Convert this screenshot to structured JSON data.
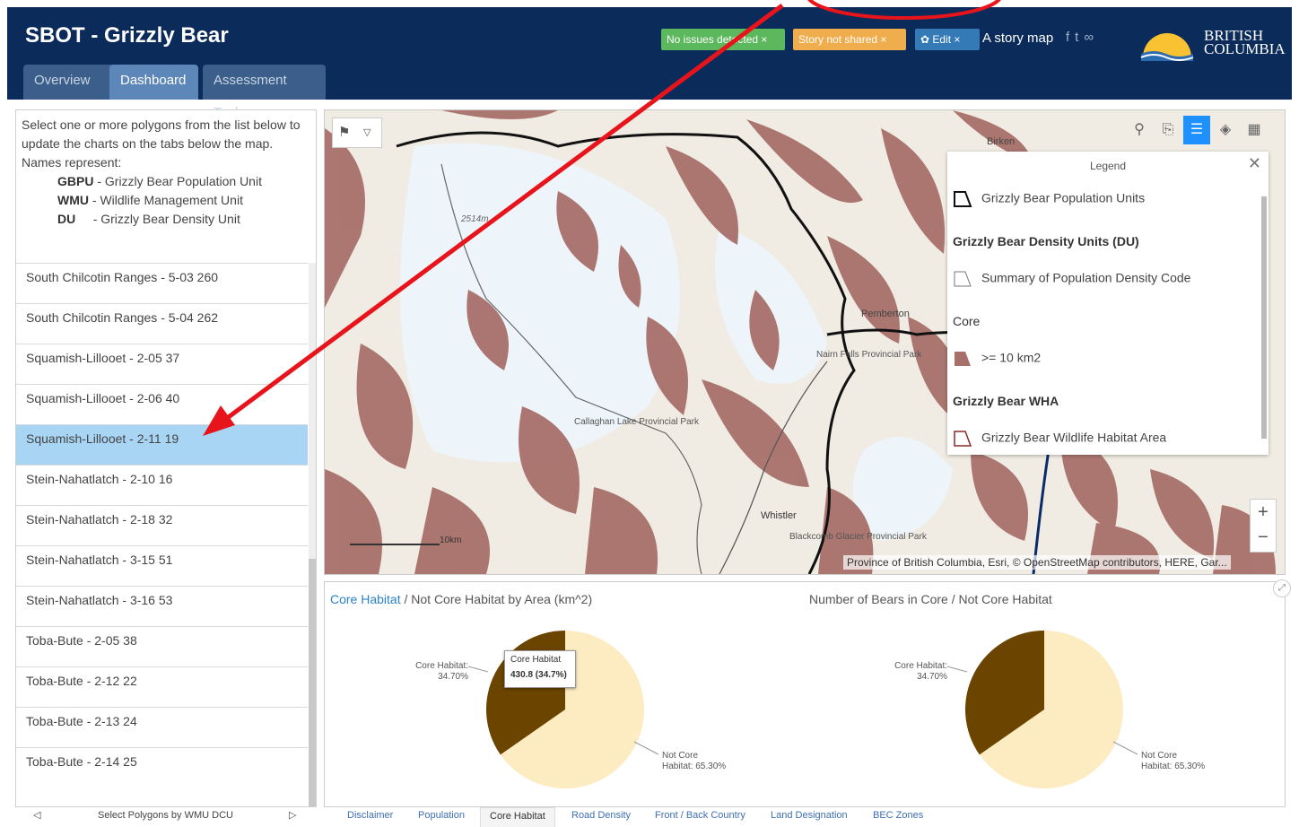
{
  "header": {
    "title": "SBOT - Grizzly Bear",
    "tabs": [
      {
        "label": "Overview"
      },
      {
        "label": "Dashboard"
      },
      {
        "label": "Assessment Tool"
      }
    ],
    "badges": {
      "issues": "No issues detected ×",
      "story": "Story not shared ×",
      "edit": "Edit ×"
    },
    "story_map": "A story map",
    "logo_line1": "BRITISH",
    "logo_line2": "COLUMBIA",
    "colors": {
      "header_bg": "#0b2b5a",
      "badge_green": "#5cb85c",
      "badge_orange": "#f0ad4e",
      "badge_blue": "#337ab7"
    }
  },
  "left_panel": {
    "intro": "Select one or more polygons from the list below to update the charts on the tabs below the map. Names represent:",
    "legend": [
      {
        "code": "GBPU",
        "desc": "- Grizzly Bear Population Unit"
      },
      {
        "code": "WMU",
        "desc": "- Wildlife Management Unit"
      },
      {
        "code": "DU",
        "desc": "- Grizzly Bear Density Unit"
      }
    ],
    "items": [
      "South Chilcotin Ranges - 5-03  260",
      "South Chilcotin Ranges - 5-04  262",
      "Squamish-Lillooet - 2-05  37",
      "Squamish-Lillooet - 2-06  40",
      "Squamish-Lillooet - 2-11  19",
      "Stein-Nahatlatch - 2-10  16",
      "Stein-Nahatlatch - 2-18  32",
      "Stein-Nahatlatch - 3-15  51",
      "Stein-Nahatlatch - 3-16  53",
      "Toba-Bute - 2-05  38",
      "Toba-Bute - 2-12  22",
      "Toba-Bute - 2-13  24",
      "Toba-Bute - 2-14  25"
    ],
    "selected_index": 4,
    "pager_label": "Select Polygons by WMU DCU",
    "pager_prev": "◁",
    "pager_next": "▷"
  },
  "map": {
    "place_labels": [
      "Birken",
      "Pemberton",
      "Nairn Falls Provincial Park",
      "Callaghan Lake Provincial Park",
      "Whistler",
      "Blackcomb Glacier Provincial Park",
      "2514m",
      "10km"
    ],
    "attribution": "Province of British Columbia, Esri, © OpenStreetMap contributors, HERE, Gar...",
    "legend": {
      "title": "Legend",
      "entries": [
        {
          "type": "item",
          "label": "Grizzly Bear Population Units"
        },
        {
          "type": "head",
          "label": "Grizzly Bear Density Units (DU)"
        },
        {
          "type": "item",
          "label": "Summary of Population Density Code"
        },
        {
          "type": "head",
          "label": "Core"
        },
        {
          "type": "item",
          "label": ">= 10 km2"
        },
        {
          "type": "head",
          "label": "Grizzly Bear WHA"
        },
        {
          "type": "item",
          "label": "Grizzly Bear Wildlife Habitat Area"
        }
      ]
    },
    "colors": {
      "core": "#a8706a",
      "snow": "#eef5fa",
      "terrain": "#f0ece3"
    }
  },
  "charts": {
    "chart1_title_hl": "Core Habitat",
    "chart1_title_rest": " / Not Core Habitat by Area (km^2)",
    "chart2_title": "Number of Bears in Core / Not Core Habitat",
    "tooltip_title": "Core Habitat",
    "tooltip_value": "430.8 (34.7%)",
    "labels": {
      "core1": "Core Habitat:",
      "core2": "34.70%",
      "not1": "Not Core",
      "not2": "Habitat: 65.30%"
    }
  },
  "chart_data": [
    {
      "type": "pie",
      "title": "Core Habitat / Not Core Habitat by Area (km^2)",
      "categories": [
        "Core Habitat",
        "Not Core Habitat"
      ],
      "values": [
        34.7,
        65.3
      ],
      "colors": [
        "#6b4400",
        "#fdebc2"
      ]
    },
    {
      "type": "pie",
      "title": "Number of Bears in Core / Not Core Habitat",
      "categories": [
        "Core Habitat",
        "Not Core Habitat"
      ],
      "values": [
        34.7,
        65.3
      ],
      "colors": [
        "#6b4400",
        "#fdebc2"
      ]
    }
  ],
  "bottom_tabs": [
    "Disclaimer",
    "Population",
    "Core Habitat",
    "Road Density",
    "Front / Back Country",
    "Land Designation",
    "BEC Zones"
  ],
  "bottom_tab_active": 2
}
